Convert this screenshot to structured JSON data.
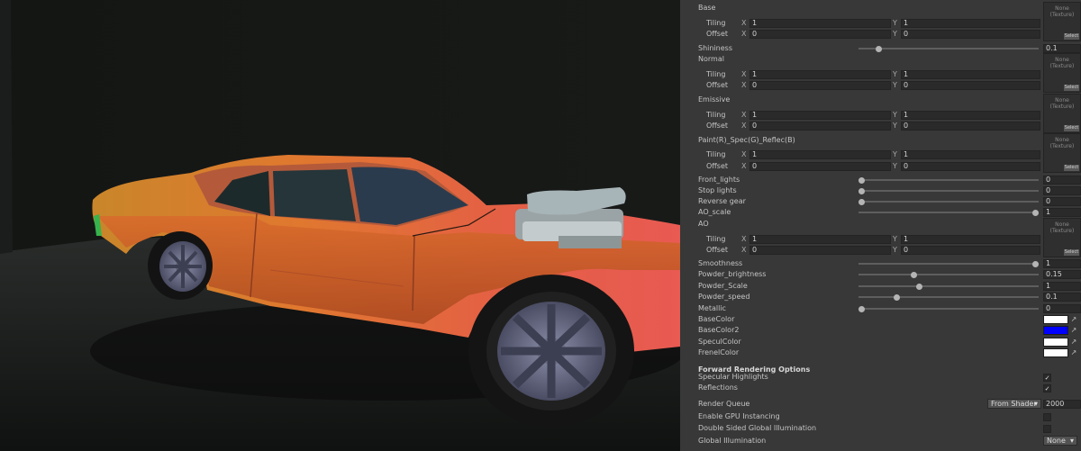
{
  "inspector": {
    "axis_x": "X",
    "axis_y": "Y",
    "textures": {
      "base": {
        "header": "Base",
        "tiling_label": "Tiling",
        "offset_label": "Offset",
        "tiling_x": "1",
        "tiling_y": "1",
        "offset_x": "0",
        "offset_y": "0",
        "slot": "None (Texture)",
        "select": "Select"
      },
      "normal": {
        "header": "Normal",
        "tiling_label": "Tiling",
        "offset_label": "Offset",
        "tiling_x": "1",
        "tiling_y": "1",
        "offset_x": "0",
        "offset_y": "0",
        "slot": "None (Texture)",
        "select": "Select"
      },
      "emissive": {
        "header": "Emissive",
        "tiling_label": "Tiling",
        "offset_label": "Offset",
        "tiling_x": "1",
        "tiling_y": "1",
        "offset_x": "0",
        "offset_y": "0",
        "slot": "None (Texture)",
        "select": "Select"
      },
      "paint": {
        "header": "Paint(R)_Spec(G)_Reflec(B)",
        "tiling_label": "Tiling",
        "offset_label": "Offset",
        "tiling_x": "1",
        "tiling_y": "1",
        "offset_x": "0",
        "offset_y": "0",
        "slot": "None (Texture)",
        "select": "Select"
      },
      "ao": {
        "header": "AO",
        "tiling_label": "Tiling",
        "offset_label": "Offset",
        "tiling_x": "1",
        "tiling_y": "1",
        "offset_x": "0",
        "offset_y": "0",
        "slot": "None (Texture)",
        "select": "Select"
      }
    },
    "sliders": {
      "shininess": {
        "label": "Shininess",
        "value": "0.1",
        "fraction": 0.1
      },
      "front_lights": {
        "label": "Front_lights",
        "value": "0",
        "fraction": 0
      },
      "stop_lights": {
        "label": "Stop lights",
        "value": "0",
        "fraction": 0
      },
      "reverse_gear": {
        "label": "Reverse gear",
        "value": "0",
        "fraction": 0
      },
      "ao_scale": {
        "label": "AO_scale",
        "value": "1",
        "fraction": 1
      },
      "smoothness": {
        "label": "Smoothness",
        "value": "1",
        "fraction": 1
      },
      "powder_brightness": {
        "label": "Powder_brightness",
        "value": "0.15",
        "fraction": 0.3
      },
      "powder_scale": {
        "label": "Powder_Scale",
        "value": "1",
        "fraction": 0.33
      },
      "powder_speed": {
        "label": "Powder_speed",
        "value": "0.1",
        "fraction": 0.2
      },
      "metallic": {
        "label": "Metallic",
        "value": "0",
        "fraction": 0
      }
    },
    "colors": {
      "base_color": {
        "label": "BaseColor",
        "swatch": "#ffffff"
      },
      "base_color2": {
        "label": "BaseColor2",
        "swatch": "#0000ff"
      },
      "specul_color": {
        "label": "SpeculColor",
        "swatch": "#ffffff"
      },
      "frenel_color": {
        "label": "FrenelColor",
        "swatch": "#ffffff"
      }
    },
    "forward_rendering": {
      "header": "Forward Rendering Options",
      "specular_highlights": {
        "label": "Specular Highlights",
        "checked": true
      },
      "reflections": {
        "label": "Reflections",
        "checked": true
      }
    },
    "render_queue": {
      "label": "Render Queue",
      "mode": "From Shader",
      "value": "2000"
    },
    "gpu_instancing": {
      "label": "Enable GPU Instancing",
      "checked": false
    },
    "double_sided_gi": {
      "label": "Double Sided Global Illumination",
      "checked": false
    },
    "global_illumination": {
      "label": "Global Illumination",
      "value": "None"
    },
    "check_glyph": "✓",
    "dropdown_arrow": "▾",
    "picker_icon": "eyedropper-icon"
  },
  "viewport": {
    "subject": "orange muscle car with blower engine",
    "accent": "#e86a3c"
  }
}
